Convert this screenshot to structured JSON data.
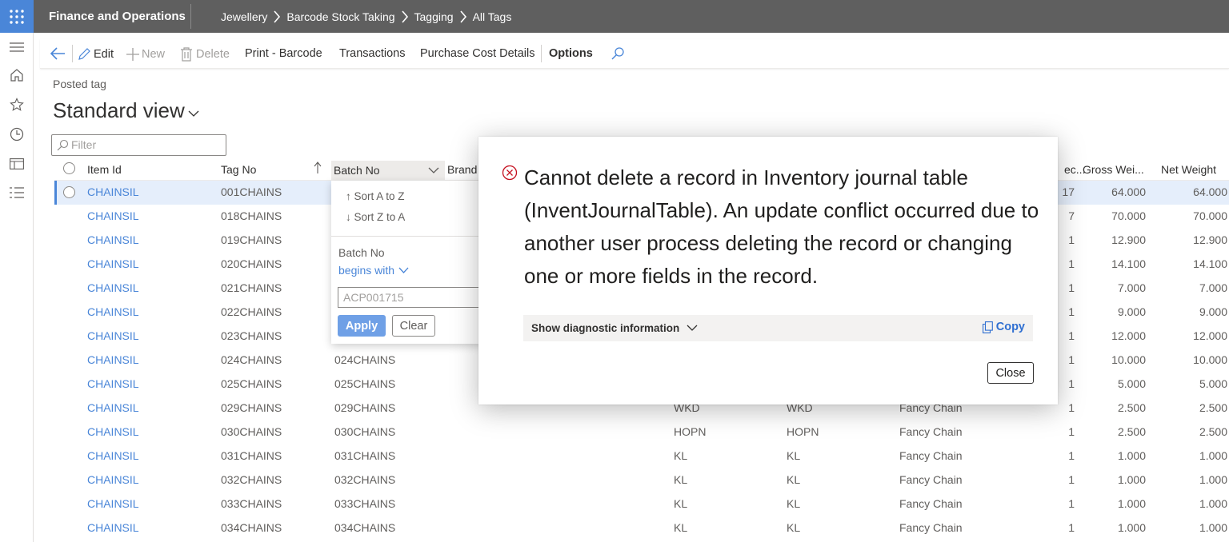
{
  "topbar": {
    "app_name": "Finance and Operations",
    "breadcrumbs": [
      "Jewellery",
      "Barcode Stock Taking",
      "Tagging",
      "All Tags"
    ]
  },
  "actions": {
    "edit": "Edit",
    "new": "New",
    "delete": "Delete",
    "print_barcode": "Print - Barcode",
    "transactions": "Transactions",
    "purchase_cost_details": "Purchase Cost Details",
    "options": "Options"
  },
  "page": {
    "record_type": "Posted tag",
    "view_title": "Standard view",
    "filter_placeholder": "Filter"
  },
  "grid": {
    "headers": {
      "item_id": "Item Id",
      "tag_no": "Tag No",
      "batch_no": "Batch No",
      "brand": "Brand",
      "pieces": "ec...",
      "gross_weight": "Gross Wei...",
      "net_weight": "Net Weight"
    },
    "rows": [
      {
        "item_id": "CHAINSIL",
        "tag_no": "001CHAINS",
        "batch_no": "",
        "col_a": "",
        "col_b": "",
        "col_c": "",
        "pcs": "17",
        "gross": "64.000",
        "net": "64.000"
      },
      {
        "item_id": "CHAINSIL",
        "tag_no": "018CHAINS",
        "batch_no": "",
        "col_a": "",
        "col_b": "",
        "col_c": "",
        "pcs": "7",
        "gross": "70.000",
        "net": "70.000"
      },
      {
        "item_id": "CHAINSIL",
        "tag_no": "019CHAINS",
        "batch_no": "",
        "col_a": "",
        "col_b": "",
        "col_c": "",
        "pcs": "1",
        "gross": "12.900",
        "net": "12.900"
      },
      {
        "item_id": "CHAINSIL",
        "tag_no": "020CHAINS",
        "batch_no": "",
        "col_a": "",
        "col_b": "",
        "col_c": "",
        "pcs": "1",
        "gross": "14.100",
        "net": "14.100"
      },
      {
        "item_id": "CHAINSIL",
        "tag_no": "021CHAINS",
        "batch_no": "",
        "col_a": "",
        "col_b": "",
        "col_c": "",
        "pcs": "1",
        "gross": "7.000",
        "net": "7.000"
      },
      {
        "item_id": "CHAINSIL",
        "tag_no": "022CHAINS",
        "batch_no": "",
        "col_a": "",
        "col_b": "",
        "col_c": "",
        "pcs": "1",
        "gross": "9.000",
        "net": "9.000"
      },
      {
        "item_id": "CHAINSIL",
        "tag_no": "023CHAINS",
        "batch_no": "",
        "col_a": "",
        "col_b": "",
        "col_c": "",
        "pcs": "1",
        "gross": "12.000",
        "net": "12.000"
      },
      {
        "item_id": "CHAINSIL",
        "tag_no": "024CHAINS",
        "batch_no": "024CHAINS",
        "col_a": "",
        "col_b": "",
        "col_c": "",
        "pcs": "1",
        "gross": "10.000",
        "net": "10.000"
      },
      {
        "item_id": "CHAINSIL",
        "tag_no": "025CHAINS",
        "batch_no": "025CHAINS",
        "col_a": "",
        "col_b": "",
        "col_c": "",
        "pcs": "1",
        "gross": "5.000",
        "net": "5.000"
      },
      {
        "item_id": "CHAINSIL",
        "tag_no": "029CHAINS",
        "batch_no": "029CHAINS",
        "col_a": "WKD",
        "col_b": "WKD",
        "col_c": "Fancy Chain",
        "pcs": "1",
        "gross": "2.500",
        "net": "2.500"
      },
      {
        "item_id": "CHAINSIL",
        "tag_no": "030CHAINS",
        "batch_no": "030CHAINS",
        "col_a": "HOPN",
        "col_b": "HOPN",
        "col_c": "Fancy Chain",
        "pcs": "1",
        "gross": "2.500",
        "net": "2.500"
      },
      {
        "item_id": "CHAINSIL",
        "tag_no": "031CHAINS",
        "batch_no": "031CHAINS",
        "col_a": "KL",
        "col_b": "KL",
        "col_c": "Fancy Chain",
        "pcs": "1",
        "gross": "1.000",
        "net": "1.000"
      },
      {
        "item_id": "CHAINSIL",
        "tag_no": "032CHAINS",
        "batch_no": "032CHAINS",
        "col_a": "KL",
        "col_b": "KL",
        "col_c": "Fancy Chain",
        "pcs": "1",
        "gross": "1.000",
        "net": "1.000"
      },
      {
        "item_id": "CHAINSIL",
        "tag_no": "033CHAINS",
        "batch_no": "033CHAINS",
        "col_a": "KL",
        "col_b": "KL",
        "col_c": "Fancy Chain",
        "pcs": "1",
        "gross": "1.000",
        "net": "1.000"
      },
      {
        "item_id": "CHAINSIL",
        "tag_no": "034CHAINS",
        "batch_no": "034CHAINS",
        "col_a": "KL",
        "col_b": "KL",
        "col_c": "Fancy Chain",
        "pcs": "1",
        "gross": "1.000",
        "net": "1.000"
      }
    ]
  },
  "column_filter": {
    "sort_asc": "Sort A to Z",
    "sort_desc": "Sort Z to A",
    "field_label": "Batch No",
    "operator": "begins with",
    "value": "ACP001715",
    "apply": "Apply",
    "clear": "Clear"
  },
  "dialog": {
    "message": "Cannot delete a record in Inventory journal table (InventJournalTable). An update conflict occurred due to another user process deleting the record or changing one or more fields in the record.",
    "diagnostic_label": "Show diagnostic information",
    "copy_label": "Copy",
    "close_label": "Close"
  },
  "colors": {
    "topbar": "#5f5f5f",
    "accent": "#4a86d8",
    "error": "#c50f1f"
  },
  "icons": [
    "waffle-icon",
    "chevron-right-icon",
    "hamburger-icon",
    "home-icon",
    "star-icon",
    "clock-icon",
    "workspace-icon",
    "list-icon",
    "back-arrow-icon",
    "edit-icon",
    "plus-icon",
    "trash-icon",
    "search-icon",
    "error-icon",
    "copy-icon"
  ]
}
